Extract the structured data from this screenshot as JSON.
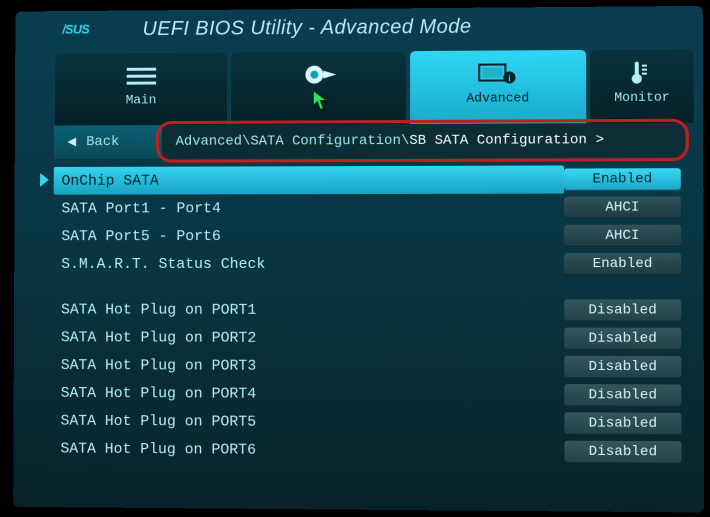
{
  "header": {
    "brand": "ASUS",
    "title": "UEFI BIOS Utility - Advanced Mode"
  },
  "tabs": [
    {
      "id": "main",
      "label": "Main"
    },
    {
      "id": "tweaker",
      "label": ""
    },
    {
      "id": "advanced",
      "label": "Advanced",
      "active": true
    },
    {
      "id": "monitor",
      "label": "Monitor"
    }
  ],
  "back_label": "Back",
  "breadcrumb": {
    "segments": [
      "Advanced\\",
      " SATA Configuration\\"
    ],
    "current": " SB SATA Configuration >"
  },
  "settings": [
    {
      "label": "OnChip SATA",
      "value": "Enabled",
      "style": "enabled",
      "selected": true
    },
    {
      "label": "SATA Port1 - Port4",
      "value": "AHCI",
      "style": "dim"
    },
    {
      "label": "SATA Port5 - Port6",
      "value": "AHCI",
      "style": "dim"
    },
    {
      "label": "S.M.A.R.T. Status Check",
      "value": "Enabled",
      "style": "dim"
    }
  ],
  "hotplug": [
    {
      "label": "SATA Hot Plug on PORT1",
      "value": "Disabled",
      "style": "disabled"
    },
    {
      "label": "SATA Hot Plug on PORT2",
      "value": "Disabled",
      "style": "disabled"
    },
    {
      "label": "SATA Hot Plug on PORT3",
      "value": "Disabled",
      "style": "disabled"
    },
    {
      "label": "SATA Hot Plug on PORT4",
      "value": "Disabled",
      "style": "disabled"
    },
    {
      "label": "SATA Hot Plug on PORT5",
      "value": "Disabled",
      "style": "disabled"
    },
    {
      "label": "SATA Hot Plug on PORT6",
      "value": "Disabled",
      "style": "disabled"
    }
  ]
}
